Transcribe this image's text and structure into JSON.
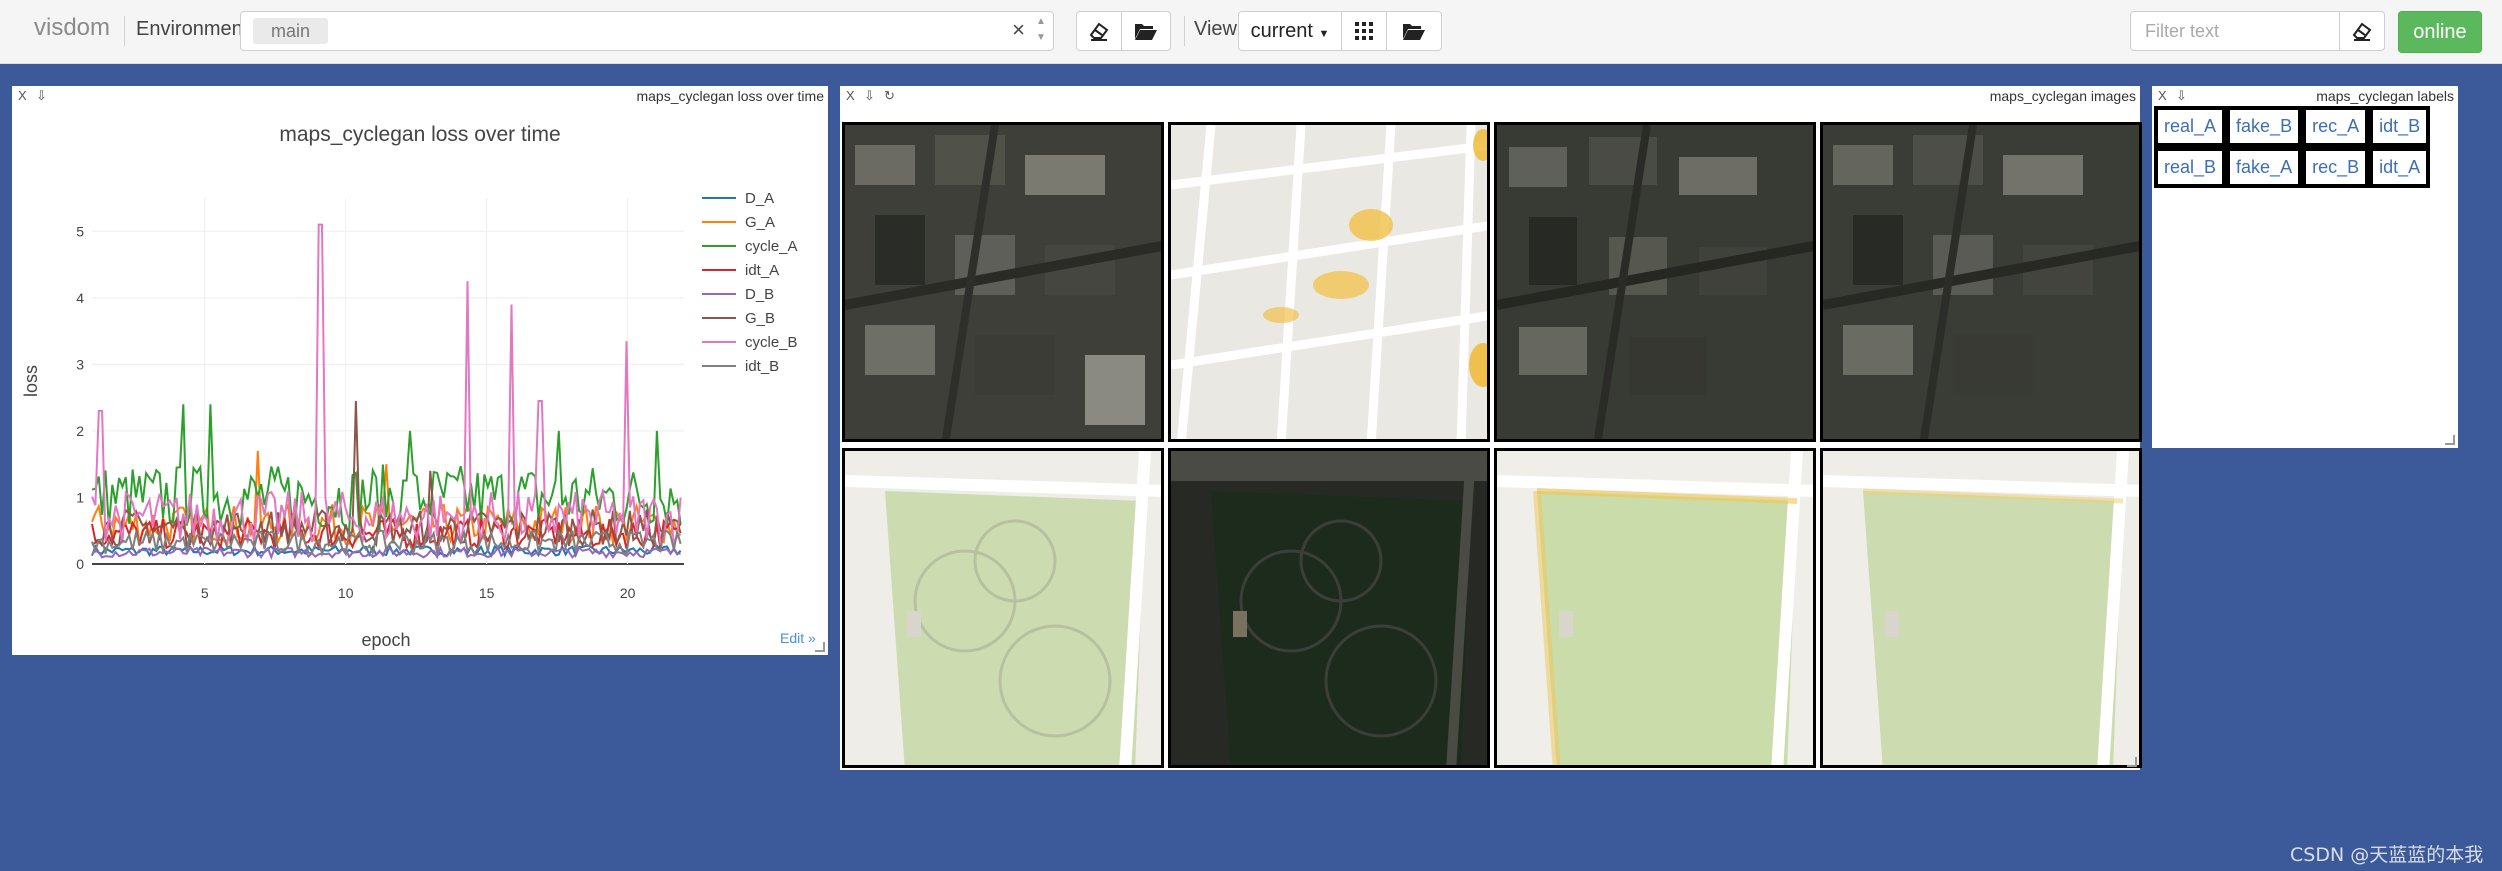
{
  "app": {
    "brand": "visdom"
  },
  "toolbar": {
    "environment_label": "Environment",
    "environment_tag": "main",
    "clear_glyph": "×",
    "view_label": "View",
    "view_value": "current",
    "filter_placeholder": "Filter text",
    "online_label": "online"
  },
  "loss_pane": {
    "close": "X",
    "save": "⇩",
    "title": "maps_cyclegan loss over time",
    "edit_label": "Edit »"
  },
  "images_pane": {
    "close": "X",
    "save": "⇩",
    "refresh": "↻",
    "title": "maps_cyclegan images"
  },
  "labels_pane": {
    "close": "X",
    "save": "⇩",
    "title": "maps_cyclegan labels",
    "rows": [
      [
        "real_A",
        "fake_B",
        "rec_A",
        "idt_B"
      ],
      [
        "real_B",
        "fake_A",
        "rec_B",
        "idt_A"
      ]
    ]
  },
  "watermark": "CSDN @天蓝蓝的本我",
  "chart_data": {
    "type": "line",
    "title": "maps_cyclegan loss over time",
    "xlabel": "epoch",
    "ylabel": "loss",
    "xlim": [
      1,
      22
    ],
    "ylim": [
      0,
      5.5
    ],
    "xticks": [
      5,
      10,
      15,
      20
    ],
    "yticks": [
      0,
      1,
      2,
      3,
      4,
      5
    ],
    "grid": true,
    "legend_position": "right",
    "series": [
      {
        "name": "D_A",
        "color": "#1f77b4",
        "base": 0.25,
        "amp": 0.15,
        "spikes": []
      },
      {
        "name": "G_A",
        "color": "#ff7f0e",
        "base": 0.6,
        "amp": 0.6,
        "spikes": [
          [
            6.9,
            1.7
          ],
          [
            11.4,
            1.5
          ]
        ]
      },
      {
        "name": "cycle_A",
        "color": "#2ca02c",
        "base": 1.0,
        "amp": 1.0,
        "spikes": [
          [
            4.2,
            2.4
          ],
          [
            5.2,
            2.4
          ],
          [
            12.3,
            2.0
          ],
          [
            17.6,
            2.0
          ],
          [
            21.0,
            2.0
          ]
        ]
      },
      {
        "name": "idt_A",
        "color": "#d62728",
        "base": 0.45,
        "amp": 0.45,
        "spikes": []
      },
      {
        "name": "D_B",
        "color": "#9467bd",
        "base": 0.2,
        "amp": 0.15,
        "spikes": []
      },
      {
        "name": "G_B",
        "color": "#8c564b",
        "base": 0.55,
        "amp": 0.55,
        "spikes": [
          [
            10.4,
            2.45
          ],
          [
            13.0,
            1.4
          ]
        ]
      },
      {
        "name": "cycle_B",
        "color": "#e377c2",
        "base": 0.6,
        "amp": 0.8,
        "spikes": [
          [
            1.3,
            2.3
          ],
          [
            9.1,
            5.1
          ],
          [
            14.3,
            4.25
          ],
          [
            15.9,
            3.9
          ],
          [
            16.9,
            2.45
          ],
          [
            20.0,
            3.35
          ]
        ]
      },
      {
        "name": "idt_B",
        "color": "#7f7f7f",
        "base": 0.3,
        "amp": 0.35,
        "spikes": []
      }
    ]
  }
}
